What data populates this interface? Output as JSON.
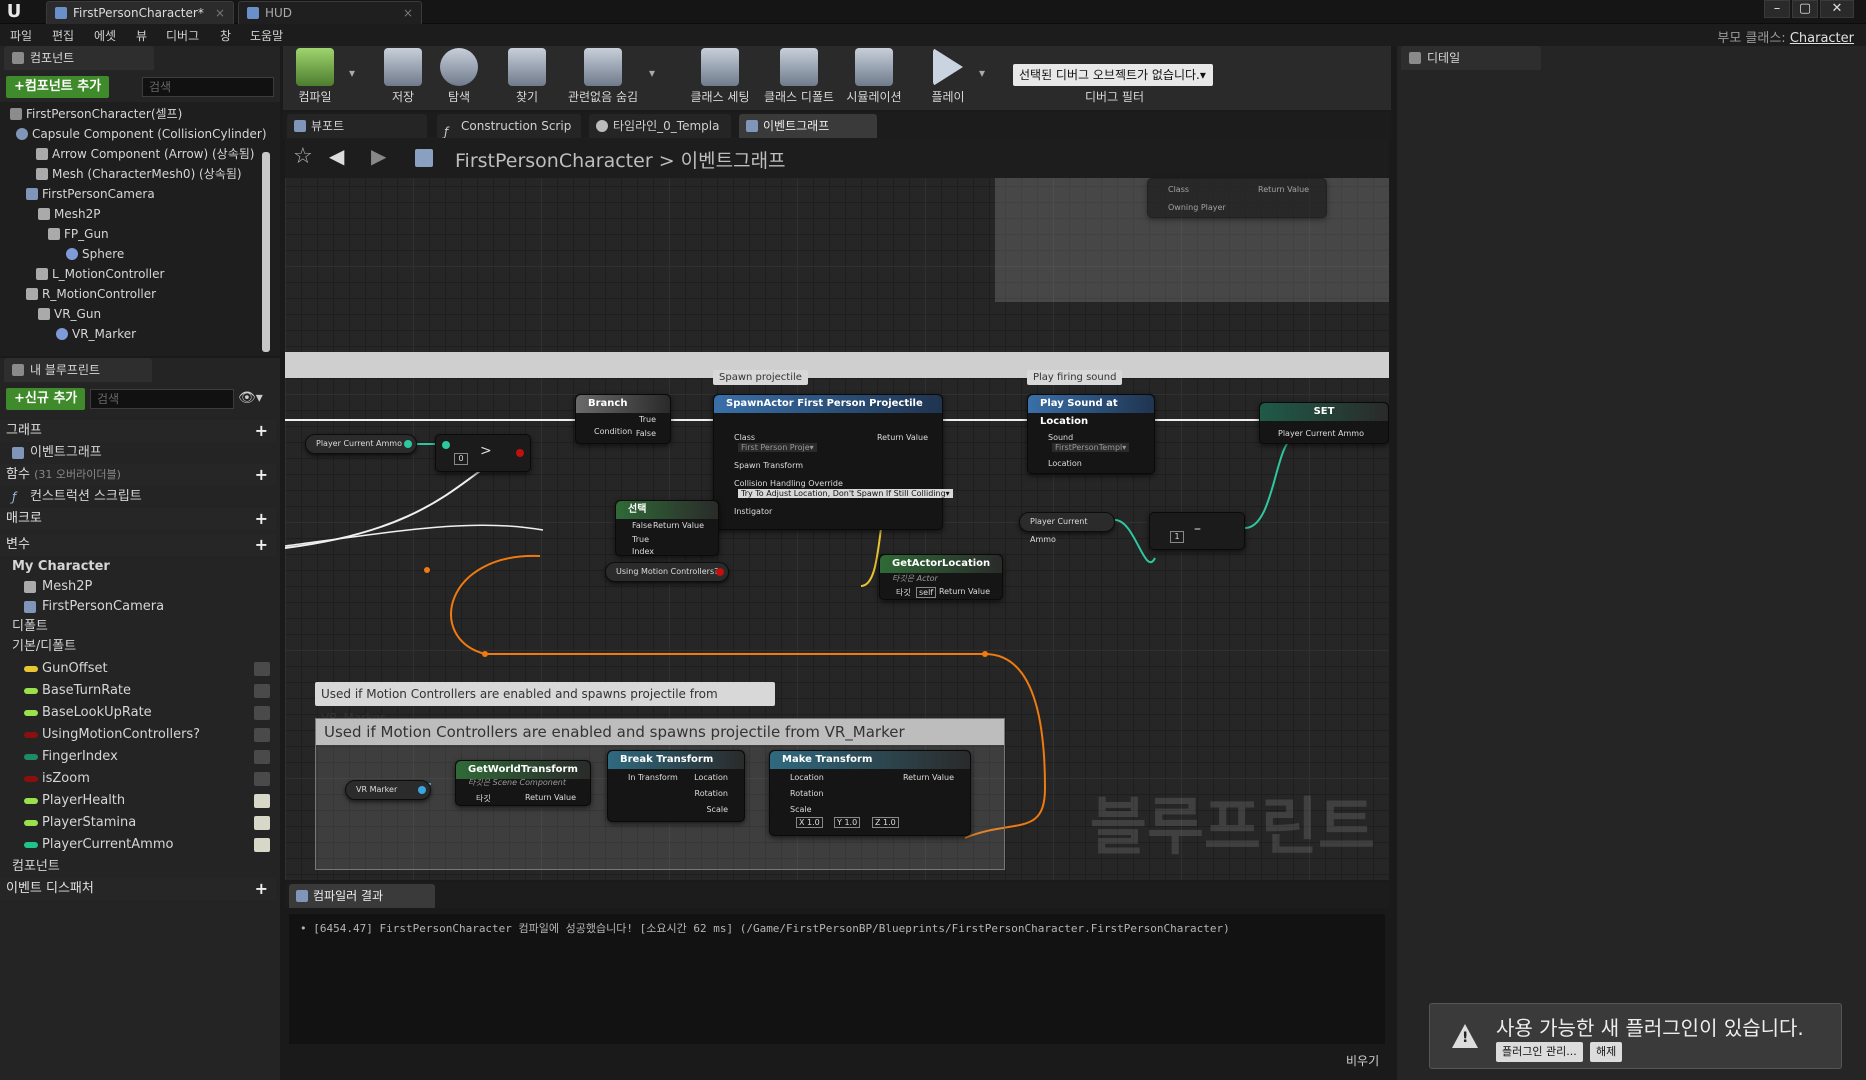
{
  "title_bar": {
    "tabs": [
      {
        "label": "FirstPersonCharacter*"
      },
      {
        "label": "HUD"
      }
    ]
  },
  "menu": {
    "items": [
      "파일",
      "편집",
      "에셋",
      "뷰",
      "디버그",
      "창",
      "도움말"
    ],
    "parent_class_label": "부모 클래스:",
    "parent_class_value": "Character"
  },
  "components": {
    "tab_label": "컴포넌트",
    "add_button": "+컴포넌트 추가",
    "search_placeholder": "검색",
    "tree": [
      "FirstPersonCharacter(셀프)",
      "Capsule Component (CollisionCylinder)",
      "Arrow Component (Arrow) (상속됨)",
      "Mesh (CharacterMesh0) (상속됨)",
      "FirstPersonCamera",
      "Mesh2P",
      "FP_Gun",
      "Sphere",
      "L_MotionController",
      "R_MotionController",
      "VR_Gun",
      "VR_Marker"
    ]
  },
  "my_blueprint": {
    "tab_label": "내 블루프린트",
    "add_button": "+신규 추가",
    "search_placeholder": "검색",
    "categories": {
      "graphs": "그래프",
      "event_graph": "이벤트그래프",
      "functions": "함수",
      "functions_note": "(31 오버라이더블)",
      "construction_script": "컨스트럭션 스크립트",
      "macros": "매크로",
      "variables": "변수",
      "my_character": "My Character",
      "mesh2p": "Mesh2P",
      "first_person_camera": "FirstPersonCamera",
      "defaults": "디폴트",
      "basic_defaults": "기본/디폴트",
      "components": "컴포넌트",
      "event_dispatchers": "이벤트 디스패처"
    },
    "variables": [
      {
        "name": "GunOffset",
        "color": "#e8c631",
        "visible": false
      },
      {
        "name": "BaseTurnRate",
        "color": "#9ae04a",
        "visible": false
      },
      {
        "name": "BaseLookUpRate",
        "color": "#9ae04a",
        "visible": false
      },
      {
        "name": "UsingMotionControllers?",
        "color": "#8a1010",
        "visible": false
      },
      {
        "name": "FingerIndex",
        "color": "#1e8a6a",
        "visible": false
      },
      {
        "name": "isZoom",
        "color": "#8a1010",
        "visible": false
      },
      {
        "name": "PlayerHealth",
        "color": "#9ae04a",
        "visible": true
      },
      {
        "name": "PlayerStamina",
        "color": "#9ae04a",
        "visible": true
      },
      {
        "name": "PlayerCurrentAmmo",
        "color": "#1ec488",
        "visible": true
      }
    ]
  },
  "toolbar": {
    "buttons": [
      "컴파일",
      "저장",
      "탐색",
      "찾기",
      "관련없음 숨김",
      "클래스 세팅",
      "클래스 디폴트",
      "시뮬레이션",
      "플레이"
    ],
    "debug_select": "선택된 디버그 오브젝트가 없습니다.▾",
    "debug_filter_label": "디버그 필터"
  },
  "editor_tabs": [
    {
      "label": "뷰포트"
    },
    {
      "label": "Construction Scrip"
    },
    {
      "label": "타임라인_0_Templa"
    },
    {
      "label": "이벤트그래프"
    }
  ],
  "graph": {
    "breadcrumb_root": "FirstPersonCharacter",
    "breadcrumb_sep": ">",
    "breadcrumb_current": "이벤트그래프",
    "bubble_spawn": "Spawn projectile",
    "bubble_sound": "Play firing sound",
    "comment_small": "Used if Motion Controllers are enabled and spawns projectile from VR_Marker",
    "comment_title": "Used if Motion Controllers are enabled and spawns projectile from VR_Marker",
    "watermark": "블루프린트",
    "nodes": {
      "player_current_ammo_get": "Player Current Ammo",
      "compare_value": "0",
      "branch_title": "Branch",
      "branch_true": "True",
      "branch_false": "False",
      "branch_condition": "Condition",
      "spawn_title": "SpawnActor First Person Projectile",
      "spawn_class": "Class",
      "spawn_class_value": "First Person Proje▾",
      "spawn_transform": "Spawn Transform",
      "spawn_collision": "Collision Handling Override",
      "spawn_collision_value": "Try To Adjust Location, Don't Spawn If Still Colliding▾",
      "spawn_instigator": "Instigator",
      "spawn_return": "Return Value",
      "sound_title": "Play Sound at Location",
      "sound_sound": "Sound",
      "sound_value": "FirstPersonTempl▾",
      "sound_location": "Location",
      "set_title": "SET",
      "set_pin": "Player Current Ammo",
      "select_title": "선택",
      "select_false": "False",
      "select_true": "True",
      "select_index": "Index",
      "select_return": "Return Value",
      "using_motion": "Using Motion Controllers?",
      "get_actor_loc_title": "GetActorLocation",
      "get_actor_loc_sub": "타깃은 Actor",
      "get_actor_loc_target": "타깃",
      "get_actor_loc_self": "self",
      "get_actor_loc_return": "Return Value",
      "player_ammo_get2": "Player Current Ammo",
      "minus_value": "1",
      "vr_marker": "VR Marker",
      "gwt_title": "GetWorldTransform",
      "gwt_sub": "타깃은 Scene Component",
      "gwt_target": "타깃",
      "gwt_return": "Return Value",
      "break_title": "Break Transform",
      "break_in": "In Transform",
      "break_loc": "Location",
      "break_rot": "Rotation",
      "break_scale": "Scale",
      "make_title": "Make Transform",
      "make_loc": "Location",
      "make_rot": "Rotation",
      "make_scale": "Scale",
      "make_return": "Return Value",
      "make_sx": "1.0",
      "make_sy": "1.0",
      "make_sz": "1.0",
      "top_class": "Class",
      "top_return": "Return Value",
      "top_owner": "Owning Player"
    }
  },
  "compiler": {
    "tab_label": "컴파일러 결과",
    "log_line": "[6454.47] FirstPersonCharacter 컴파일에 성공했습니다! [소요시간 62 ms] (/Game/FirstPersonBP/Blueprints/FirstPersonCharacter.FirstPersonCharacter)",
    "clear_button": "비우기"
  },
  "details": {
    "tab_label": "디테일"
  },
  "toast": {
    "message": "사용 가능한 새 플러그인이 있습니다.",
    "manage_button": "플러그인 관리...",
    "dismiss_button": "해제"
  }
}
